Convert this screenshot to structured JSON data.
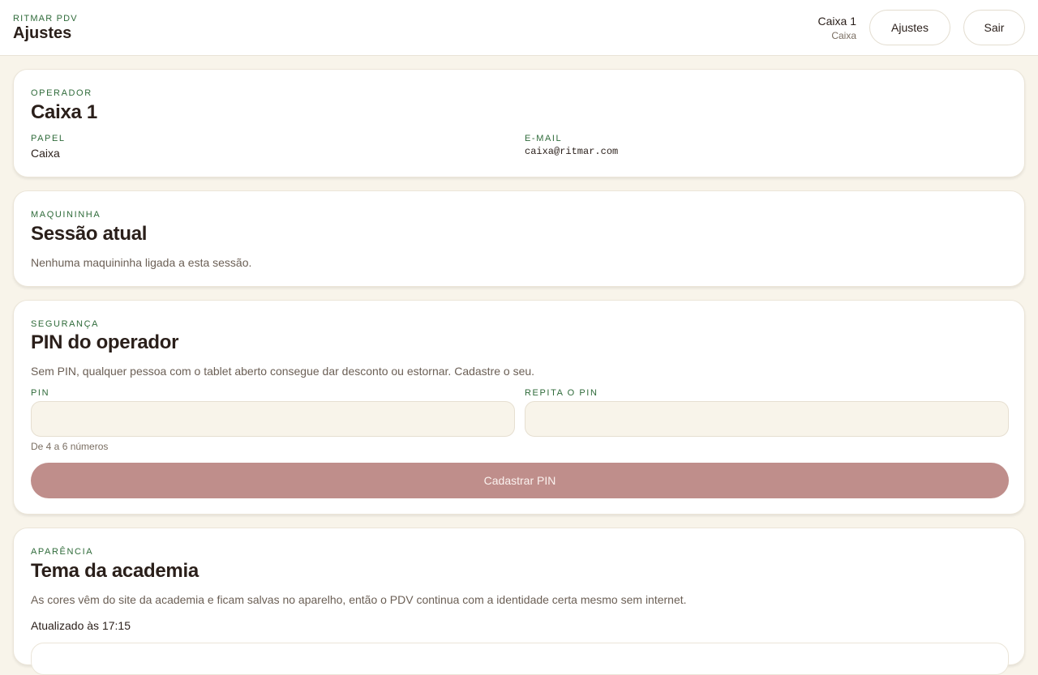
{
  "header": {
    "brand": "RITMAR PDV",
    "title": "Ajustes",
    "user_name": "Caixa 1",
    "user_role": "Caixa",
    "ajustes_label": "Ajustes",
    "sair_label": "Sair"
  },
  "operator": {
    "eyebrow": "OPERADOR",
    "name": "Caixa 1",
    "role_label": "PAPEL",
    "role_value": "Caixa",
    "email_label": "E-MAIL",
    "email_value": "caixa@ritmar.com"
  },
  "terminal": {
    "eyebrow": "MAQUININHA",
    "title": "Sessão atual",
    "description": "Nenhuma maquininha ligada a esta sessão."
  },
  "security": {
    "eyebrow": "SEGURANÇA",
    "title": "PIN do operador",
    "description": "Sem PIN, qualquer pessoa com o tablet aberto consegue dar desconto ou estornar. Cadastre o seu.",
    "pin_label": "PIN",
    "pin_value": "",
    "repeat_label": "REPITA O PIN",
    "repeat_value": "",
    "hint": "De 4 a 6 números",
    "submit_label": "Cadastrar PIN",
    "submit_color": "#bf8e8b"
  },
  "appearance": {
    "eyebrow": "APARÊNCIA",
    "title": "Tema da academia",
    "description": "As cores vêm do site da academia e ficam salvas no aparelho, então o PDV continua com a identidade certa mesmo sem internet.",
    "updated": "Atualizado às 17:15"
  },
  "colors": {
    "accent_green": "#2f6b3a",
    "background": "#f8f4ea",
    "text": "#2a1f1a"
  }
}
